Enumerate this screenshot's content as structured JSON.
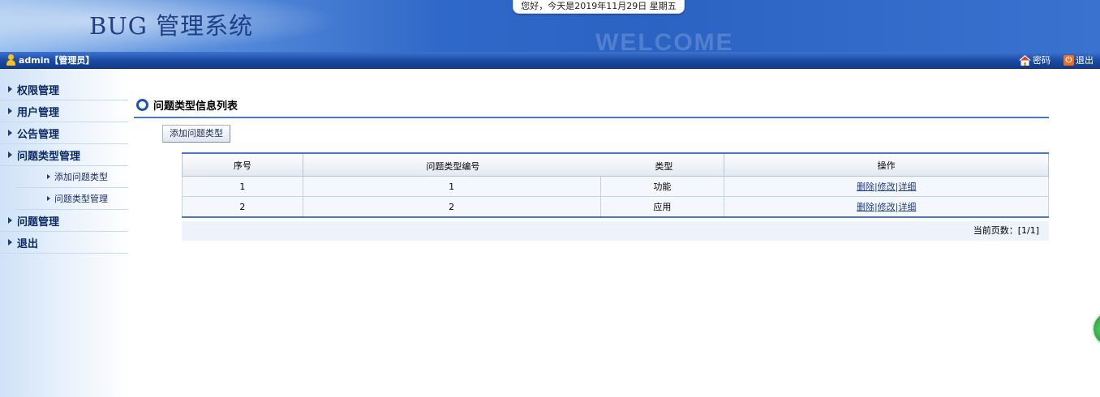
{
  "header": {
    "title": "BUG 管理系统",
    "watermark": "WELCOME",
    "date_text": "您好，今天是2019年11月29日 星期五"
  },
  "userbar": {
    "user": "admin【管理员】",
    "password_label": "密码",
    "logout_label": "退出"
  },
  "sidebar": {
    "items": [
      {
        "label": "权限管理"
      },
      {
        "label": "用户管理"
      },
      {
        "label": "公告管理"
      },
      {
        "label": "问题类型管理"
      },
      {
        "label": "添加问题类型"
      },
      {
        "label": "问题类型管理"
      },
      {
        "label": "问题管理"
      },
      {
        "label": "退出"
      }
    ]
  },
  "main": {
    "title": "问题类型信息列表",
    "add_button": "添加问题类型",
    "table": {
      "headers": [
        "序号",
        "问题类型编号",
        "类型",
        "操作"
      ],
      "rows": [
        {
          "index": "1",
          "code": "1",
          "type": "功能"
        },
        {
          "index": "2",
          "code": "2",
          "type": "应用"
        }
      ],
      "actions": {
        "delete": "删除",
        "sep": "|",
        "edit": "修改",
        "detail": "详细"
      }
    },
    "pager": "当前页数：[1/1]"
  },
  "colors": {
    "header_blue": "#2b63c3",
    "title_text": "#1f3f86",
    "accent_rule": "#4b78c5",
    "link": "#1a3a8c"
  }
}
